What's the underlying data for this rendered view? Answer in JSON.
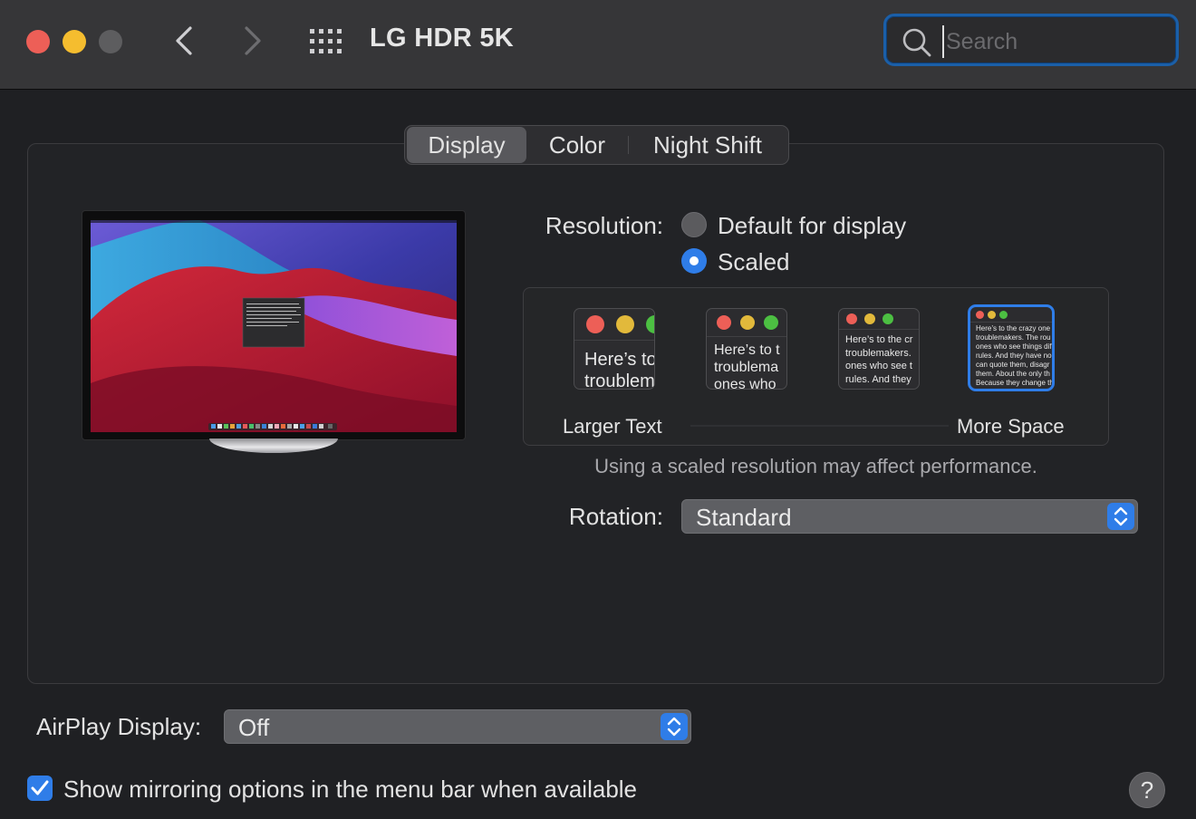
{
  "window": {
    "title": "LG HDR 5K",
    "search": {
      "placeholder": "Search",
      "value": ""
    }
  },
  "tabs": [
    {
      "label": "Display",
      "selected": true
    },
    {
      "label": "Color",
      "selected": false
    },
    {
      "label": "Night Shift",
      "selected": false
    }
  ],
  "resolution": {
    "label": "Resolution:",
    "options": [
      {
        "label": "Default for display",
        "selected": false
      },
      {
        "label": "Scaled",
        "selected": true
      }
    ],
    "scale_options": [
      {
        "preview_text": "Here’s to t\ntroublem",
        "selected": false
      },
      {
        "preview_text": "Here’s to t\ntroublema\nones who",
        "selected": false
      },
      {
        "preview_text": "Here’s to the cr\ntroublemakers.\nones who see t\nrules. And they",
        "selected": false
      },
      {
        "preview_text": "Here’s to the crazy one\ntroublemakers. The rou\nones who see things dif\nrules. And they have no\ncan quote them, disagr\nthem. About the only th\nBecause they change th",
        "selected": true
      }
    ],
    "scale_left_label": "Larger Text",
    "scale_right_label": "More Space",
    "performance_note": "Using a scaled resolution may affect performance."
  },
  "rotation": {
    "label": "Rotation:",
    "value": "Standard"
  },
  "airplay": {
    "label": "AirPlay Display:",
    "value": "Off"
  },
  "mirroring": {
    "label": "Show mirroring options in the menu bar when available",
    "checked": true
  },
  "help": {
    "label": "?"
  },
  "colors": {
    "accent": "#2f7de8",
    "close": "#ed5f57",
    "minimize": "#f5bd2f",
    "zoom_disabled": "#5d5d5f"
  },
  "icons": {
    "back": "chevron-left-icon",
    "forward": "chevron-right-icon",
    "show_all": "grid-icon",
    "search": "magnifying-glass-icon",
    "popup": "up-down-chevron-icon",
    "check": "checkmark-icon"
  }
}
